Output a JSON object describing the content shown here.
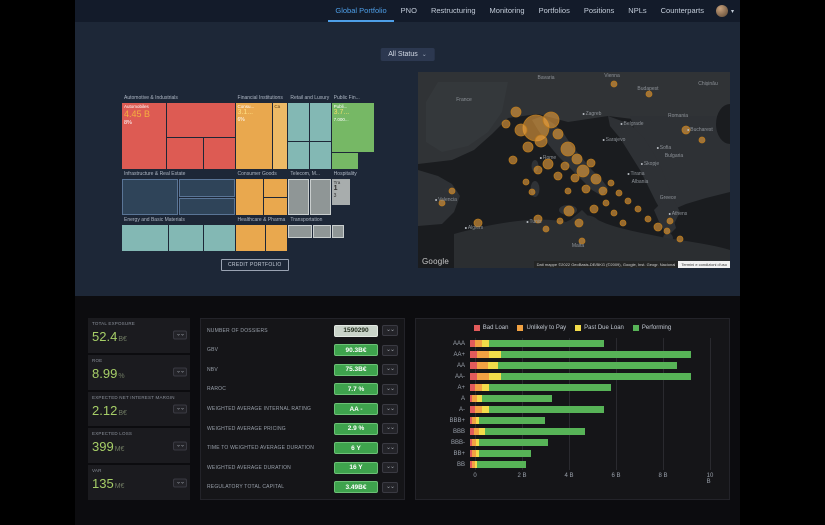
{
  "topbar": {
    "tabs": [
      {
        "label": "Global Portfolio",
        "active": true
      },
      {
        "label": "PNO",
        "active": false
      },
      {
        "label": "Restructuring",
        "active": false
      },
      {
        "label": "Monitoring",
        "active": false
      },
      {
        "label": "Portfolios",
        "active": false
      },
      {
        "label": "Positions",
        "active": false
      },
      {
        "label": "NPLs",
        "active": false
      },
      {
        "label": "Counterparts",
        "active": false
      }
    ]
  },
  "filter": {
    "status_label": "All Status"
  },
  "icons": {
    "caret": "⌄",
    "expand": "⌄⌄",
    "avatar_caret": "▾"
  },
  "colors": {
    "accent_blue": "#4E9FE8",
    "badge_green": "#3EA34D",
    "kpi_green": "#A6CE67",
    "upper_bg": "#1D2737",
    "topbar_bg": "#131B2A"
  },
  "treemap": {
    "button": "CREDIT PORTFOLIO",
    "groups": {
      "automotive": {
        "title": "Automotive & Industrials",
        "tile_label": "Automobiles",
        "tile_value": "4.45 B",
        "tile_sub": "8%"
      },
      "financial": {
        "title": "Financial Institutions",
        "tile_label": "Consu...",
        "tile_value": "3.1...",
        "tile_sub": "6%",
        "tile2_label": "Ca"
      },
      "retail": {
        "title": "Retail and Luxury"
      },
      "public": {
        "title": "Public Fin...",
        "tile_label": "Publi...",
        "tile_value": "3.7...",
        "tile_sub": "7.000..."
      },
      "infrastructure": {
        "title": "Infrastructure & Real Estate"
      },
      "consumer": {
        "title": "Consumer Goods"
      },
      "telecom": {
        "title": "Telecom, M..."
      },
      "hospitality": {
        "title": "Hospitality",
        "tile_label": "Tra",
        "tile_value": "1",
        "tile_sub": "3"
      },
      "energy": {
        "title": "Energy and Basic Materials"
      },
      "healthcare": {
        "title": "Healthcare & Pharma"
      },
      "transportation": {
        "title": "Transportation"
      }
    }
  },
  "map": {
    "labels": [
      "Bavaria",
      "Vienna",
      "Budapest",
      "Chișinău",
      "France",
      "Zagreb",
      "Romania",
      "Belgrade",
      "Bucharest",
      "Sarajevo",
      "Sofia",
      "Bulgaria",
      "Skopje",
      "Tirana",
      "Albania",
      "Greece",
      "Athens",
      "Rome",
      "Valencia",
      "Algiers",
      "Tunis",
      "Malta"
    ],
    "logo": "Google",
    "attribution": "Dati mappe ©2022 GeoBasis-DE/BKG (©2009), Google, Inst. Geogr. Nacional",
    "terms": "Termini e condizioni d'uso"
  },
  "kpis": [
    {
      "label": "TOTAL EXPOSURE",
      "value": "52.4",
      "unit": "B€"
    },
    {
      "label": "ROE",
      "value": "8.99",
      "unit": "%"
    },
    {
      "label": "EXPECTED NET INTEREST MARGIN",
      "value": "2.12",
      "unit": "B€"
    },
    {
      "label": "EXPECTED LOSS",
      "value": "399",
      "unit": "M€"
    },
    {
      "label": "VAR",
      "value": "135",
      "unit": "M€"
    }
  ],
  "metrics": [
    {
      "label": "NUMBER OF DOSSIERS",
      "value": "1590290",
      "style": "light"
    },
    {
      "label": "GBV",
      "value": "90.3B€",
      "style": "green"
    },
    {
      "label": "NBV",
      "value": "75.3B€",
      "style": "green"
    },
    {
      "label": "RAROC",
      "value": "7.7 %",
      "style": "green"
    },
    {
      "label": "WEIGHTED AVERAGE INTERNAL RATING",
      "value": "AA -",
      "style": "green"
    },
    {
      "label": "WEIGHTED AVERAGE PRICING",
      "value": "2.9 %",
      "style": "green"
    },
    {
      "label": "TIME TO WEIGHTED AVERAGE DURATION",
      "value": "6 Y",
      "style": "green"
    },
    {
      "label": "WEIGHTED AVERAGE DURATION",
      "value": "16 Y",
      "style": "green"
    },
    {
      "label": "REGULATORY TOTAL CAPITAL",
      "value": "3.49B€",
      "style": "green"
    }
  ],
  "chart_data": {
    "type": "bar",
    "orientation": "horizontal",
    "stacked": true,
    "categories": [
      "AAA",
      "AA+",
      "AA",
      "AA-",
      "A+",
      "A",
      "A-",
      "BBB+",
      "BBB",
      "BBB-",
      "BB+",
      "BB"
    ],
    "series": [
      {
        "name": "Bad Loan",
        "color": "#E25B5B",
        "values": [
          0.2,
          0.3,
          0.3,
          0.3,
          0.2,
          0.1,
          0.2,
          0.1,
          0.15,
          0.1,
          0.1,
          0.1
        ]
      },
      {
        "name": "Unlikely to Pay",
        "color": "#F2A243",
        "values": [
          0.3,
          0.5,
          0.45,
          0.5,
          0.3,
          0.2,
          0.3,
          0.15,
          0.25,
          0.15,
          0.15,
          0.1
        ]
      },
      {
        "name": "Past Due Loan",
        "color": "#F2DC4A",
        "values": [
          0.3,
          0.5,
          0.45,
          0.5,
          0.3,
          0.2,
          0.3,
          0.15,
          0.25,
          0.15,
          0.15,
          0.1
        ]
      },
      {
        "name": "Performing",
        "color": "#57B357",
        "values": [
          4.9,
          8.1,
          7.6,
          8.1,
          5.2,
          3.0,
          4.9,
          2.8,
          4.25,
          2.9,
          2.2,
          2.1
        ]
      }
    ],
    "xticks": [
      "0",
      "2 B",
      "4 B",
      "6 B",
      "8 B",
      "10 B"
    ],
    "xlim": [
      0,
      10
    ],
    "legend_position": "top",
    "grid": true
  }
}
